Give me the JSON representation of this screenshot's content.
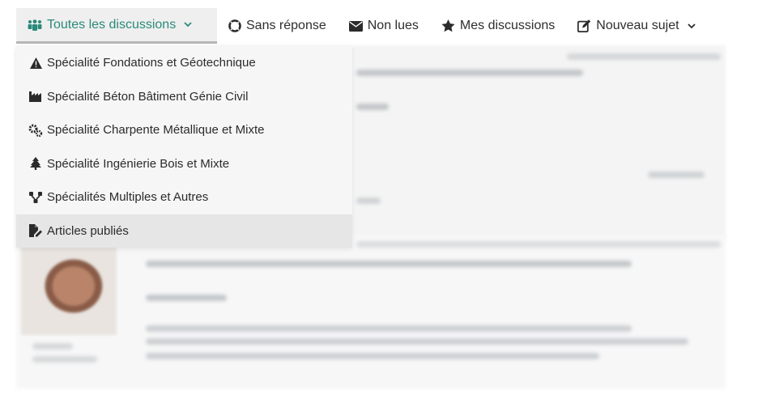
{
  "nav": {
    "all_discussions": "Toutes les discussions",
    "unanswered": "Sans réponse",
    "unread": "Non lues",
    "my_discussions": "Mes discussions",
    "new_topic": "Nouveau sujet"
  },
  "dropdown": {
    "items": [
      {
        "label": "Spécialité Fondations et Géotechnique",
        "icon": "warning-triangle-icon"
      },
      {
        "label": "Spécialité Béton Bâtiment Génie Civil",
        "icon": "industry-icon"
      },
      {
        "label": "Spécialité Charpente Métallique et Mixte",
        "icon": "cogs-icon"
      },
      {
        "label": "Spécialité Ingénierie Bois et Mixte",
        "icon": "tree-icon"
      },
      {
        "label": "Spécialités Multiples et Autres",
        "icon": "network-icon"
      },
      {
        "label": "Articles publiés",
        "icon": "file-signature-icon"
      }
    ]
  },
  "colors": {
    "accent": "#2a8a7a",
    "nav_active_bg": "#efefef",
    "dropdown_bg": "#f6f6f6",
    "dropdown_highlight": "#e6e6e6"
  }
}
